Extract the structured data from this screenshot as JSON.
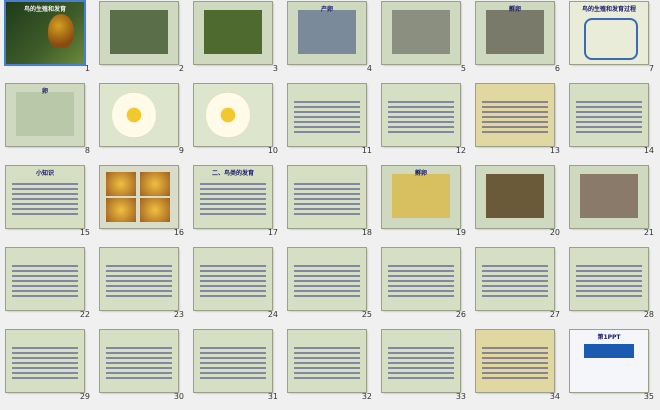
{
  "slides": [
    {
      "n": "1",
      "title": "鸟的生殖和发育",
      "theme": "dark-bird"
    },
    {
      "n": "2",
      "title": "",
      "theme": "photo-grid"
    },
    {
      "n": "3",
      "title": "",
      "theme": "photo-nest"
    },
    {
      "n": "4",
      "title": "产卵",
      "theme": "photo-egg"
    },
    {
      "n": "5",
      "title": "",
      "theme": "photo-gray"
    },
    {
      "n": "6",
      "title": "孵卵",
      "theme": "photo-hatch"
    },
    {
      "n": "7",
      "title": "鸟的生殖和发育过程",
      "theme": "diagram-cycle"
    },
    {
      "n": "8",
      "title": "卵",
      "theme": "photo-egg2"
    },
    {
      "n": "9",
      "title": "",
      "theme": "egg-diagram"
    },
    {
      "n": "10",
      "title": "",
      "theme": "egg-diagram2"
    },
    {
      "n": "11",
      "title": "",
      "theme": "text-blue"
    },
    {
      "n": "12",
      "title": "",
      "theme": "text-blue"
    },
    {
      "n": "13",
      "title": "",
      "theme": "text-yellow"
    },
    {
      "n": "14",
      "title": "",
      "theme": "text-blue"
    },
    {
      "n": "15",
      "title": "小知识",
      "theme": "text-plain"
    },
    {
      "n": "16",
      "title": "",
      "theme": "egg-photos"
    },
    {
      "n": "17",
      "title": "二、鸟类的发育",
      "theme": "text-blue"
    },
    {
      "n": "18",
      "title": "",
      "theme": "text-blue"
    },
    {
      "n": "19",
      "title": "孵卵",
      "theme": "photo-chicks"
    },
    {
      "n": "20",
      "title": "",
      "theme": "photo-chicken"
    },
    {
      "n": "21",
      "title": "",
      "theme": "photo-bird"
    },
    {
      "n": "22",
      "title": "",
      "theme": "text-blue"
    },
    {
      "n": "23",
      "title": "",
      "theme": "text-blue"
    },
    {
      "n": "24",
      "title": "",
      "theme": "text-plain"
    },
    {
      "n": "25",
      "title": "",
      "theme": "text-plain"
    },
    {
      "n": "26",
      "title": "",
      "theme": "text-plain"
    },
    {
      "n": "27",
      "title": "",
      "theme": "text-plain"
    },
    {
      "n": "28",
      "title": "",
      "theme": "text-plain"
    },
    {
      "n": "29",
      "title": "",
      "theme": "text-plain"
    },
    {
      "n": "30",
      "title": "",
      "theme": "text-plain"
    },
    {
      "n": "31",
      "title": "",
      "theme": "text-plain"
    },
    {
      "n": "32",
      "title": "",
      "theme": "text-plain"
    },
    {
      "n": "33",
      "title": "",
      "theme": "text-plain"
    },
    {
      "n": "34",
      "title": "",
      "theme": "text-yellow"
    },
    {
      "n": "35",
      "title": "第1PPT",
      "theme": "logo"
    }
  ],
  "selected_slide": "1",
  "colors": {
    "bg": "#f0f0f0",
    "slide_bg": "#c8d4b8",
    "blue_text": "#1a1a6e",
    "selection": "#4a7fd0"
  }
}
